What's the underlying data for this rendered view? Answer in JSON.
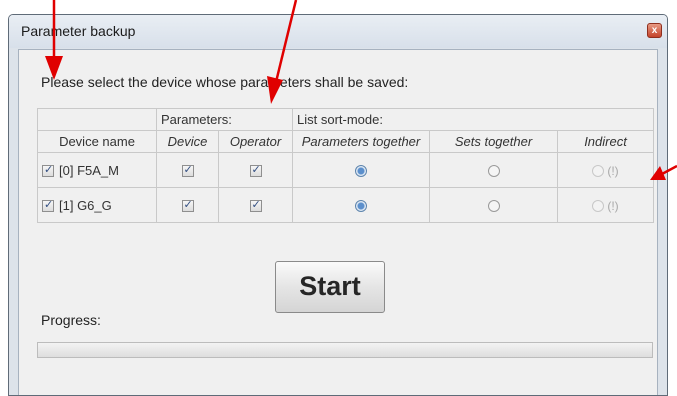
{
  "window": {
    "title": "Parameter backup",
    "close_glyph": "x"
  },
  "prompt": "Please select the device whose parameters shall be saved:",
  "table": {
    "group_headers": {
      "parameters": "Parameters:",
      "sort_mode": "List sort-mode:"
    },
    "columns": [
      "Device name",
      "Device",
      "Operator",
      "Parameters together",
      "Sets together",
      "Indirect"
    ],
    "rows": [
      {
        "device_name": "[0] F5A_M",
        "device_checked": true,
        "param_device": true,
        "param_operator": true,
        "sort_mode": "Parameters together",
        "indirect_warning": "(!)"
      },
      {
        "device_name": "[1] G6_G",
        "device_checked": true,
        "param_device": true,
        "param_operator": true,
        "sort_mode": "Parameters together",
        "indirect_warning": "(!)"
      }
    ]
  },
  "start_button": "Start",
  "progress": {
    "label": "Progress:",
    "value": 0
  },
  "annotation_arrow_color": "#e00000"
}
